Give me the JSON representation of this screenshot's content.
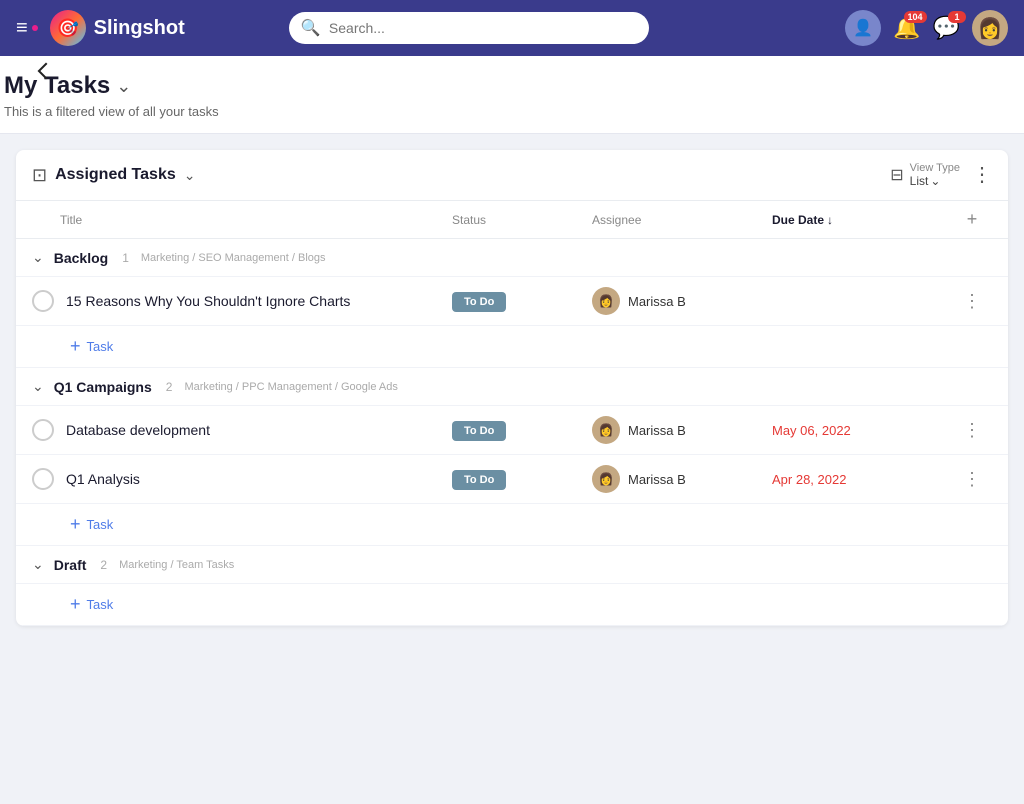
{
  "nav": {
    "menu_label": "☰",
    "logo_text": "Slingshot",
    "search_placeholder": "Search...",
    "notification_count": "104",
    "chat_count": "1"
  },
  "page": {
    "title": "My Tasks",
    "subtitle": "This is a filtered view of all your tasks"
  },
  "card": {
    "title": "Assigned Tasks",
    "view_type_label": "View Type",
    "view_type_sub": "List"
  },
  "table": {
    "col_title": "Title",
    "col_status": "Status",
    "col_assignee": "Assignee",
    "col_due_date": "Due Date",
    "sort_arrow": "↓"
  },
  "groups": [
    {
      "name": "Backlog",
      "count": "1",
      "path": "Marketing / SEO Management / Blogs",
      "tasks": [
        {
          "title": "15 Reasons Why You Shouldn't Ignore Charts",
          "status": "To Do",
          "assignee": "Marissa B",
          "due_date": "",
          "due_date_class": "normal"
        }
      ]
    },
    {
      "name": "Q1 Campaigns",
      "count": "2",
      "path": "Marketing / PPC Management / Google Ads",
      "tasks": [
        {
          "title": "Database development",
          "status": "To Do",
          "assignee": "Marissa B",
          "due_date": "May 06, 2022",
          "due_date_class": "overdue"
        },
        {
          "title": "Q1 Analysis",
          "status": "To Do",
          "assignee": "Marissa B",
          "due_date": "Apr 28, 2022",
          "due_date_class": "overdue"
        }
      ]
    },
    {
      "name": "Draft",
      "count": "2",
      "path": "Marketing / Team Tasks",
      "tasks": []
    }
  ],
  "add_task_label": "Task"
}
